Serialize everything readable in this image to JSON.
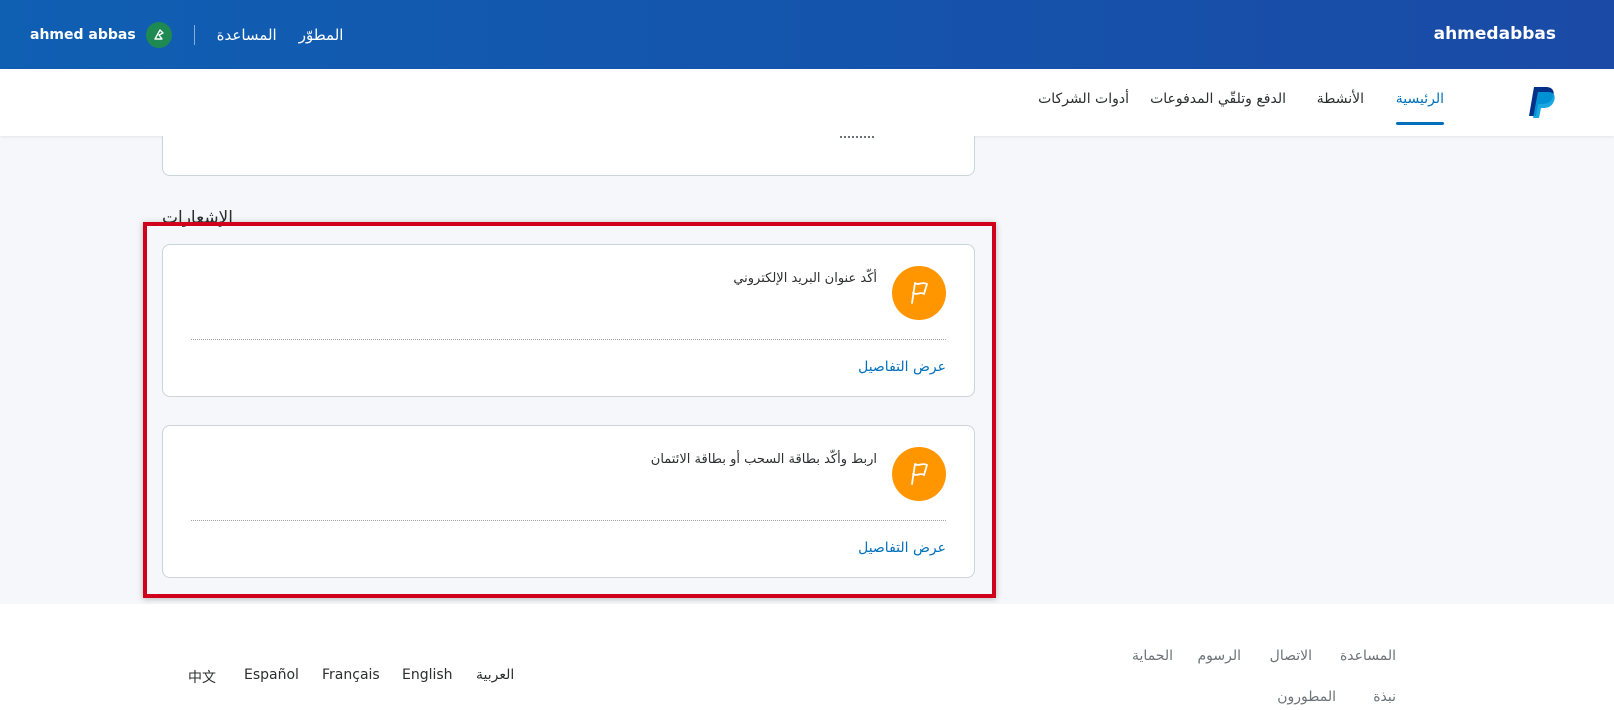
{
  "topbar": {
    "brand_user": "ahmedabbas",
    "username": "ahmed abbas",
    "links": [
      "المساعدة",
      "المطوّر"
    ]
  },
  "subnav": {
    "tabs": [
      "الرئيسية",
      "الأنشطة",
      "الدفع وتلقّي المدفوعات",
      "أدوات الشركات"
    ],
    "active_tab": "الرئيسية"
  },
  "notifications": {
    "title": "الإشعارات",
    "items": [
      {
        "message": "أكّد عنوان البريد الإلكتروني",
        "link": "عرض التفاصيل"
      },
      {
        "message": "اربط وأكّد بطاقة السحب أو بطاقة الائتمان",
        "link": "عرض التفاصيل"
      }
    ]
  },
  "footer": {
    "links": [
      "المساعدة",
      "الاتصال",
      "الرسوم",
      "الحماية",
      "نبذة",
      "المطورون"
    ],
    "languages": [
      "العربية",
      "English",
      "Français",
      "Español",
      "中文"
    ]
  },
  "colors": {
    "topbar": "#1a4aa6",
    "accent": "#0070ba",
    "flag_badge": "#ff9600",
    "highlight": "#d0021b"
  }
}
